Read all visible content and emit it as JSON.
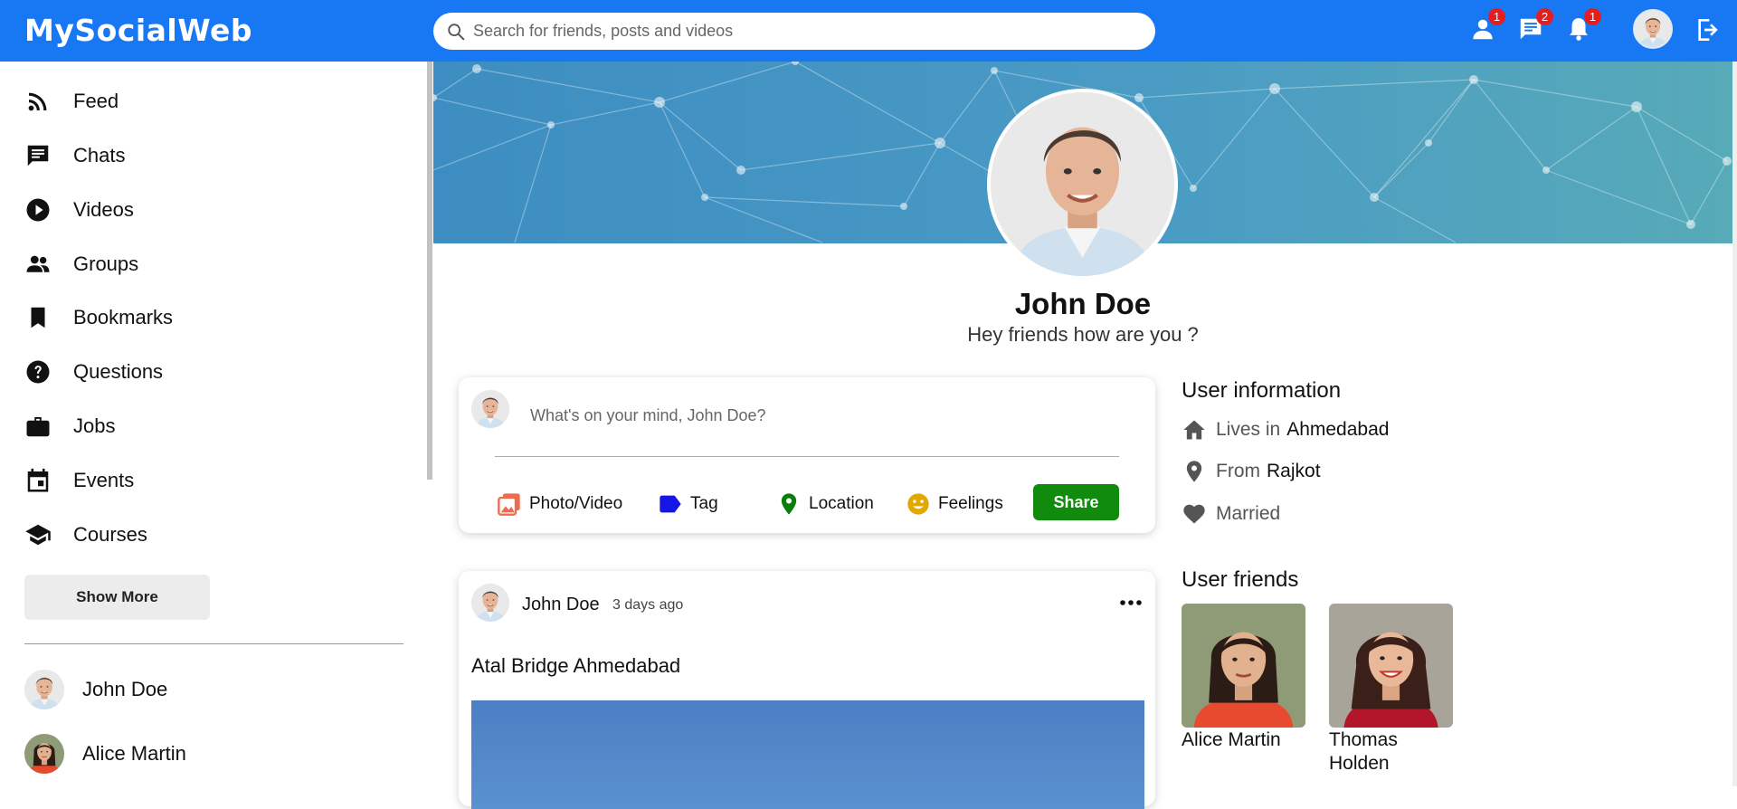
{
  "header": {
    "logo": "MySocialWeb",
    "search_placeholder": "Search for friends, posts and videos",
    "friend_requests_count": "1",
    "messages_count": "2",
    "notifications_count": "1"
  },
  "sidebar": {
    "items": [
      {
        "label": "Feed",
        "icon": "rss-icon"
      },
      {
        "label": "Chats",
        "icon": "chat-icon"
      },
      {
        "label": "Videos",
        "icon": "play-circle-icon"
      },
      {
        "label": "Groups",
        "icon": "groups-icon"
      },
      {
        "label": "Bookmarks",
        "icon": "bookmark-icon"
      },
      {
        "label": "Questions",
        "icon": "help-circle-icon"
      },
      {
        "label": "Jobs",
        "icon": "briefcase-icon"
      },
      {
        "label": "Events",
        "icon": "calendar-icon"
      },
      {
        "label": "Courses",
        "icon": "school-icon"
      }
    ],
    "show_more": "Show More",
    "friends": [
      {
        "name": "John Doe"
      },
      {
        "name": "Alice Martin"
      }
    ]
  },
  "profile": {
    "name": "John Doe",
    "status": "Hey friends how are you ?"
  },
  "composer": {
    "placeholder": "What's on your mind, John Doe?",
    "options": [
      "Photo/Video",
      "Tag",
      "Location",
      "Feelings"
    ],
    "share": "Share"
  },
  "post": {
    "author": "John Doe",
    "time": "3 days ago",
    "text": "Atal Bridge Ahmedabad"
  },
  "user_info": {
    "title": "User information",
    "lives_label": "Lives in",
    "lives_value": "Ahmedabad",
    "from_label": "From",
    "from_value": "Rajkot",
    "relationship": "Married"
  },
  "user_friends": {
    "title": "User friends",
    "items": [
      {
        "name": "Alice Martin"
      },
      {
        "name": "Thomas Holden"
      }
    ]
  },
  "colors": {
    "brand": "#1877f2",
    "share": "#118b0e",
    "badge": "#e41e1e"
  }
}
